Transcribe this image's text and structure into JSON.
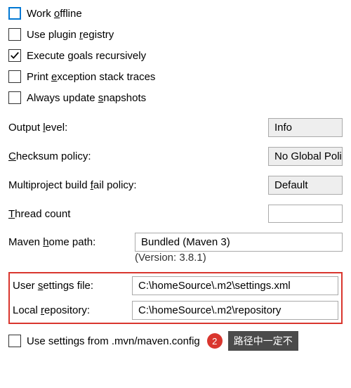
{
  "checkboxes": {
    "work_offline": {
      "pre": "Work ",
      "key": "o",
      "post": "ffline",
      "checked": false,
      "active": true
    },
    "use_plugin_registry": {
      "pre": "Use plugin ",
      "key": "r",
      "post": "egistry",
      "checked": false,
      "active": false
    },
    "execute_goals": {
      "pre": "Execute ",
      "key": "g",
      "post": "oals recursively",
      "checked": true,
      "active": false
    },
    "print_exception": {
      "pre": "Print ",
      "key": "e",
      "post": "xception stack traces",
      "checked": false,
      "active": false
    },
    "always_update": {
      "pre": "Always update ",
      "key": "s",
      "post": "napshots",
      "checked": false,
      "active": false
    },
    "use_settings_from": {
      "pre": "Use settings from .mvn/maven.config",
      "key": "",
      "post": "",
      "checked": false,
      "active": false
    }
  },
  "labels": {
    "output_level": {
      "pre": "Output ",
      "key": "l",
      "post": "evel:"
    },
    "checksum_policy": {
      "pre": "",
      "key": "C",
      "post": "hecksum policy:"
    },
    "multiproject": {
      "pre": "Multiproject build ",
      "key": "f",
      "post": "ail policy:"
    },
    "thread_count": {
      "pre": "",
      "key": "T",
      "post": "hread count"
    },
    "maven_home": {
      "pre": "Maven ",
      "key": "h",
      "post": "ome path:"
    },
    "user_settings": {
      "pre": "User ",
      "key": "s",
      "post": "ettings file:"
    },
    "local_repo": {
      "pre": "Local ",
      "key": "r",
      "post": "epository:"
    }
  },
  "values": {
    "output_level": "Info",
    "checksum_policy": "No Global Policy",
    "multiproject": "Default",
    "thread_count": "",
    "maven_home": "Bundled (Maven 3)",
    "version_note": "(Version: 3.8.1)",
    "user_settings": "C:\\homeSource\\.m2\\settings.xml",
    "local_repo": "C:\\homeSource\\.m2\\repository"
  },
  "annotation": {
    "badge": "2",
    "tooltip": "路径中一定不"
  }
}
